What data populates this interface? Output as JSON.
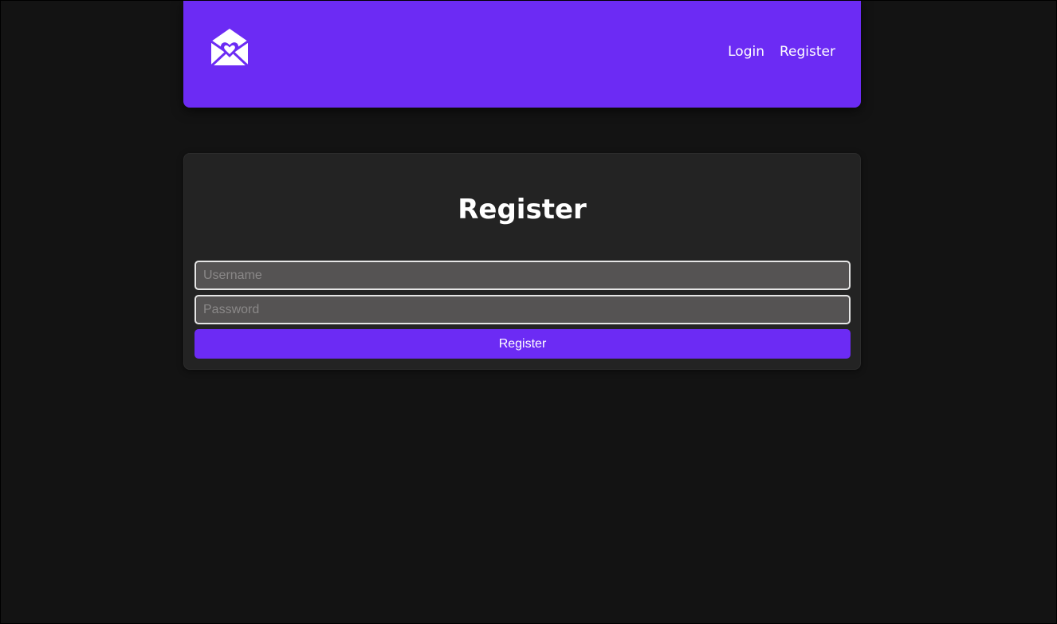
{
  "header": {
    "logo_icon": "envelope-heart-icon",
    "nav": {
      "login_label": "Login",
      "register_label": "Register"
    }
  },
  "form": {
    "title": "Register",
    "username": {
      "value": "",
      "placeholder": "Username"
    },
    "password": {
      "value": "",
      "placeholder": "Password"
    },
    "submit_label": "Register"
  },
  "colors": {
    "accent": "#6c2bf4",
    "background": "#131313",
    "card": "#232323",
    "input_background": "#555353"
  }
}
